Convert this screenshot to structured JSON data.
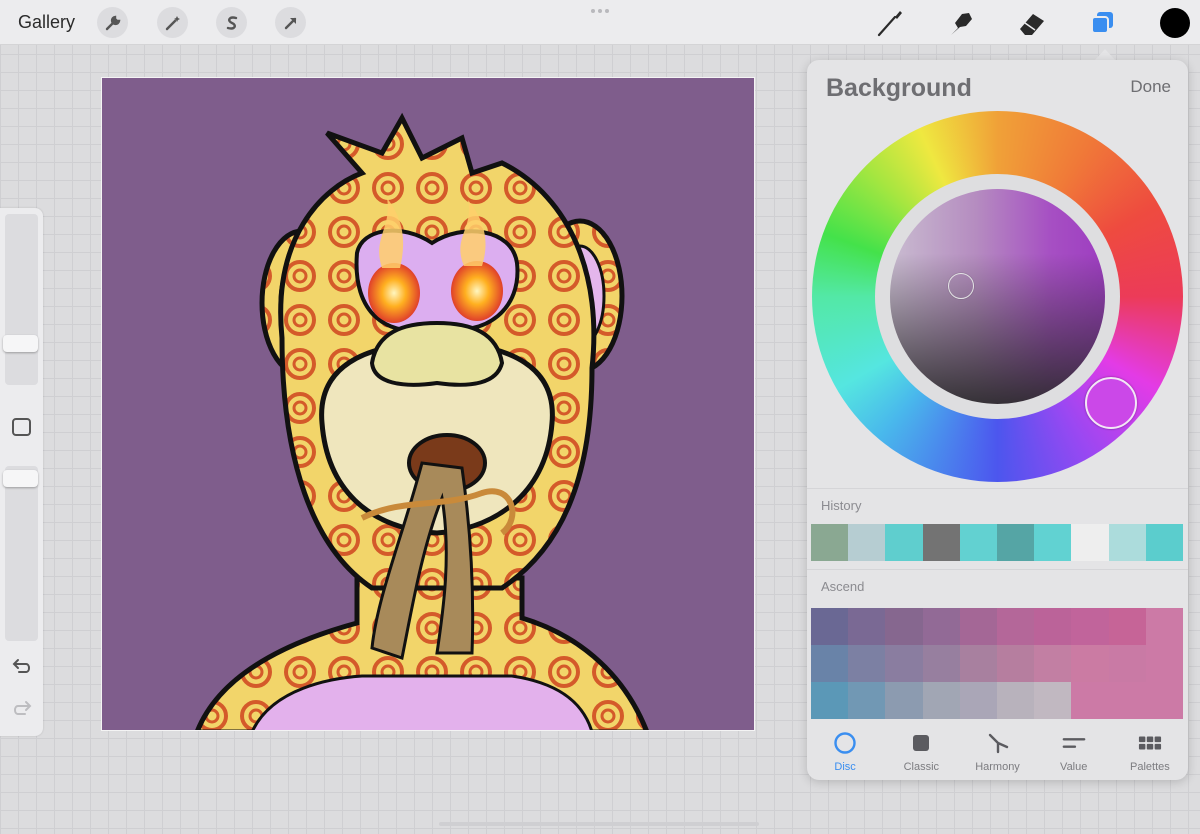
{
  "topbar": {
    "gallery_label": "Gallery",
    "left_tools": [
      "wrench-icon",
      "magic-wand-icon",
      "selection-icon",
      "transform-arrow-icon"
    ],
    "right_tools": [
      "brush-icon",
      "smudge-icon",
      "eraser-icon",
      "layers-icon"
    ],
    "current_color": "#000000"
  },
  "canvas": {
    "background_color": "#7f5d8c"
  },
  "sidebar": {
    "icons": [
      "brush-size-slider",
      "modify-button",
      "opacity-slider",
      "undo-icon",
      "redo-icon"
    ]
  },
  "color_panel": {
    "title": "Background",
    "done_label": "Done",
    "selected_color": "#cb48e8",
    "history_label": "History",
    "history_colors": [
      "#8aa892",
      "#b6cdd2",
      "#5fcece",
      "#737373",
      "#62d1d1",
      "#55a5a5",
      "#61d2d2",
      "#eeeeee",
      "#acdcdc",
      "#5bcdcd"
    ],
    "palette_label": "Ascend",
    "palette_colors": [
      "#6a6894",
      "#7a6994",
      "#86678f",
      "#926a96",
      "#a46796",
      "#b46799",
      "#bb6399",
      "#c1649b",
      "#c66497",
      "#cc7aa6",
      "#6983a8",
      "#7c80a3",
      "#8a7da0",
      "#977f9f",
      "#a8809f",
      "#b67e9f",
      "#c27fa3",
      "#cb7ba3",
      "#c97aa5",
      "#cc7aa6",
      "#5b98b7",
      "#7198b4",
      "#8c9bb0",
      "#a1a6b4",
      "#aaa6b7",
      "#b8b2bc",
      "#c1b8c1",
      "#cc7aa6",
      "#cc7aa6",
      "#cc7aa6"
    ],
    "tabs": [
      {
        "label": "Disc",
        "icon": "disc-icon",
        "active": true
      },
      {
        "label": "Classic",
        "icon": "classic-square-icon",
        "active": false
      },
      {
        "label": "Harmony",
        "icon": "harmony-icon",
        "active": false
      },
      {
        "label": "Value",
        "icon": "value-sliders-icon",
        "active": false
      },
      {
        "label": "Palettes",
        "icon": "palettes-grid-icon",
        "active": false
      }
    ]
  }
}
